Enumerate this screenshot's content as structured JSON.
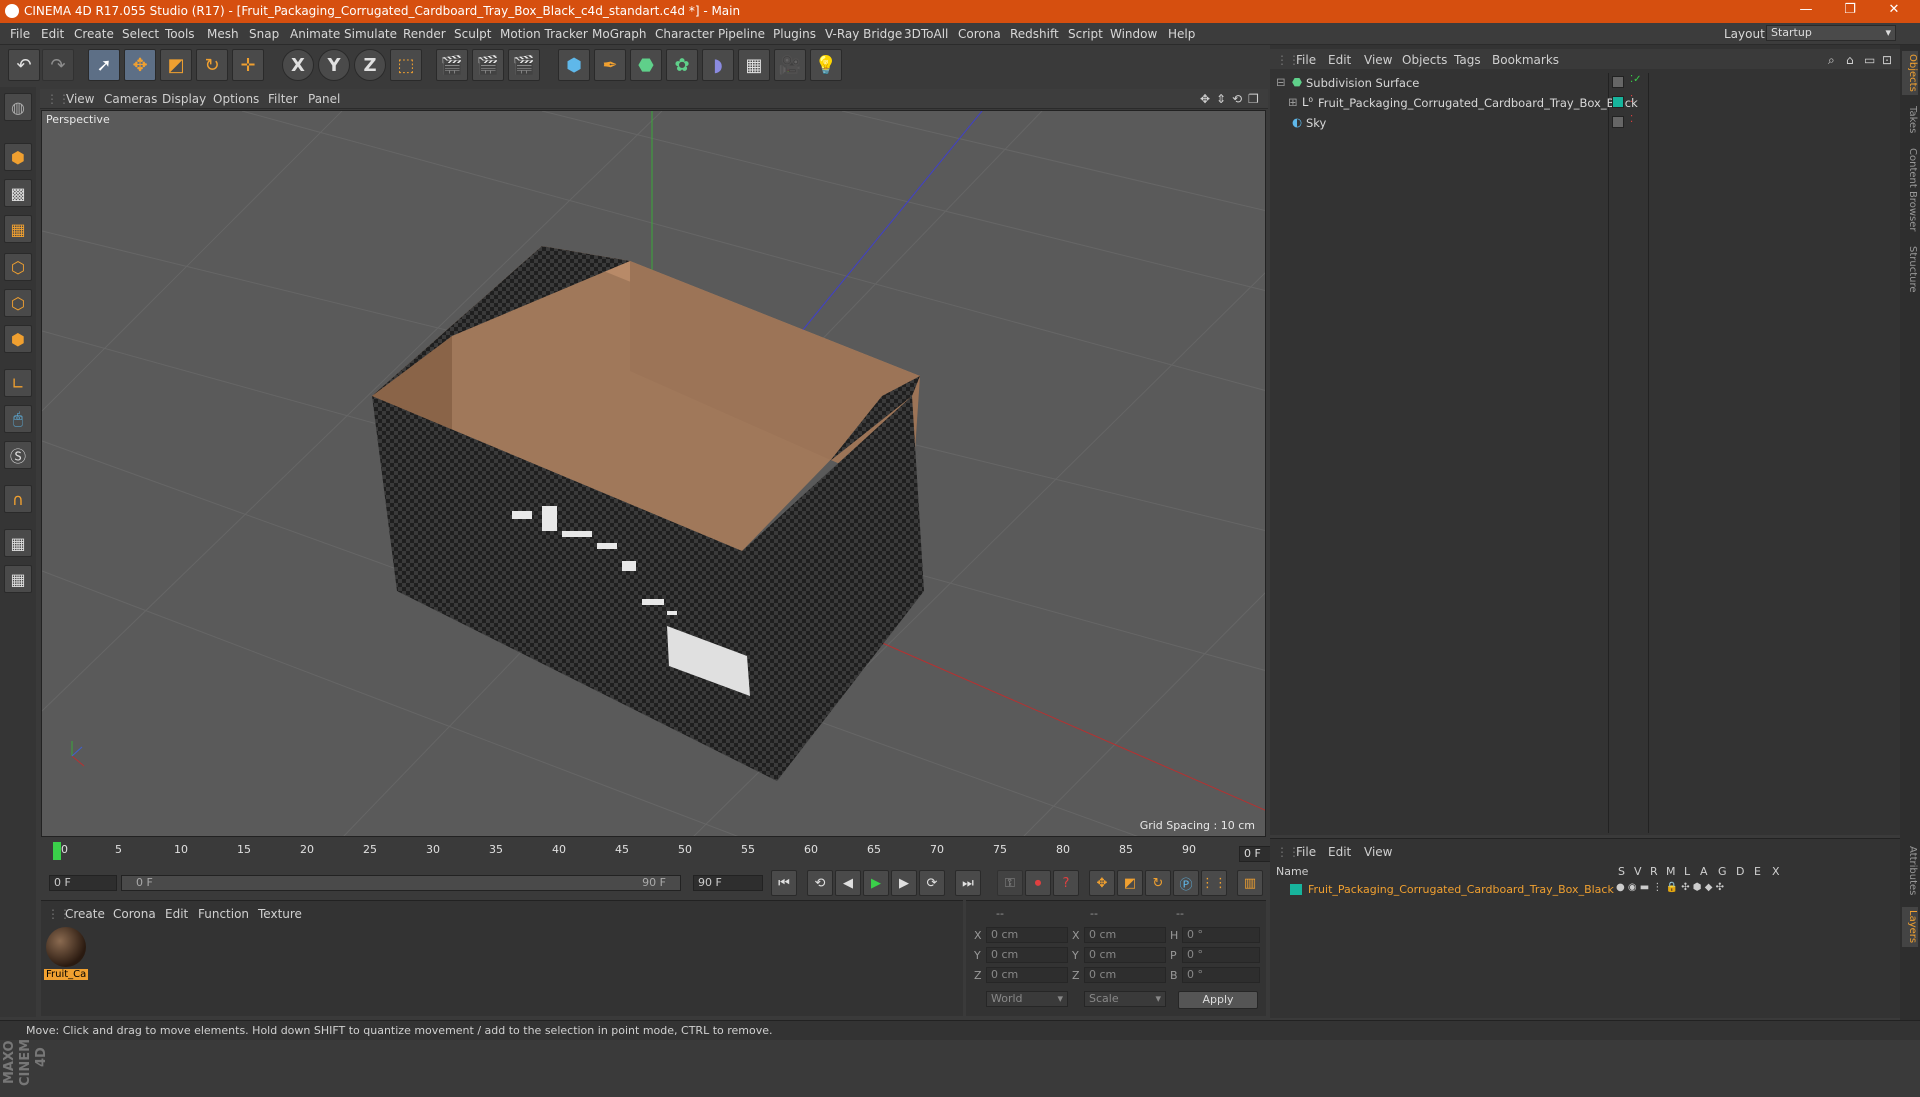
{
  "window": {
    "title": "CINEMA 4D R17.055 Studio (R17) - [Fruit_Packaging_Corrugated_Cardboard_Tray_Box_Black_c4d_standart.c4d *] - Main",
    "controls": [
      "—",
      "❐",
      "✕"
    ]
  },
  "menubar": {
    "items": [
      "File",
      "Edit",
      "Create",
      "Select",
      "Tools",
      "Mesh",
      "Snap",
      "Animate",
      "Simulate",
      "Render",
      "Sculpt",
      "Motion Tracker",
      "MoGraph",
      "Character",
      "Pipeline",
      "Plugins",
      "V-Ray Bridge",
      "3DToAll",
      "Corona",
      "Redshift",
      "Script",
      "Window",
      "Help"
    ],
    "layout_label": "Layout:",
    "layout_value": "Startup"
  },
  "toolbar": {
    "axis_x": "X",
    "axis_y": "Y",
    "axis_z": "Z"
  },
  "viewport": {
    "menu": [
      "View",
      "Cameras",
      "Display",
      "Options",
      "Filter",
      "Panel"
    ],
    "camera_label": "Perspective",
    "grid_spacing": "Grid Spacing : 10 cm"
  },
  "timeline": {
    "ticks": [
      "0",
      "5",
      "10",
      "15",
      "20",
      "25",
      "30",
      "35",
      "40",
      "45",
      "50",
      "55",
      "60",
      "65",
      "70",
      "75",
      "80",
      "85",
      "90"
    ],
    "current_frame": "0 F",
    "start_field": "0 F",
    "range_start": "0 F",
    "range_end": "90 F",
    "end_field": "90 F"
  },
  "material_panel": {
    "menu": [
      "Create",
      "Corona",
      "Edit",
      "Function",
      "Texture"
    ],
    "material_name": "Fruit_Ca"
  },
  "coord_panel": {
    "headers": [
      "--",
      "--",
      "--"
    ],
    "rows": [
      {
        "l1": "X",
        "v1": "0 cm",
        "l2": "X",
        "v2": "0 cm",
        "l3": "H",
        "v3": "0 °"
      },
      {
        "l1": "Y",
        "v1": "0 cm",
        "l2": "Y",
        "v2": "0 cm",
        "l3": "P",
        "v3": "0 °"
      },
      {
        "l1": "Z",
        "v1": "0 cm",
        "l2": "Z",
        "v2": "0 cm",
        "l3": "B",
        "v3": "0 °"
      }
    ],
    "space_select": "World",
    "mode_select": "Scale",
    "apply_label": "Apply"
  },
  "object_manager": {
    "menu": [
      "File",
      "Edit",
      "View",
      "Objects",
      "Tags",
      "Bookmarks"
    ],
    "objects": [
      {
        "name": "Subdivision Surface",
        "icon": "subdivision-icon"
      },
      {
        "name": "Fruit_Packaging_Corrugated_Cardboard_Tray_Box_Black",
        "icon": "null-object-icon"
      },
      {
        "name": "Sky",
        "icon": "sky-icon"
      }
    ]
  },
  "layer_manager": {
    "menu": [
      "File",
      "Edit",
      "View"
    ],
    "columns": [
      "Name",
      "S",
      "V",
      "R",
      "M",
      "L",
      "A",
      "G",
      "D",
      "E",
      "X"
    ],
    "layer_name": "Fruit_Packaging_Corrugated_Cardboard_Tray_Box_Black"
  },
  "right_tabs": [
    "Objects",
    "Takes",
    "Content Browser",
    "Structure",
    "Attributes",
    "Layers"
  ],
  "status": {
    "text": "Move: Click and drag to move elements. Hold down SHIFT to quantize movement / add to the selection in point mode, CTRL to remove."
  },
  "brand": "MAXON CINEMA 4D",
  "colors": {
    "titlebar": "#d64f0f",
    "accent": "#f0a030",
    "layer_color": "#17b49c"
  }
}
